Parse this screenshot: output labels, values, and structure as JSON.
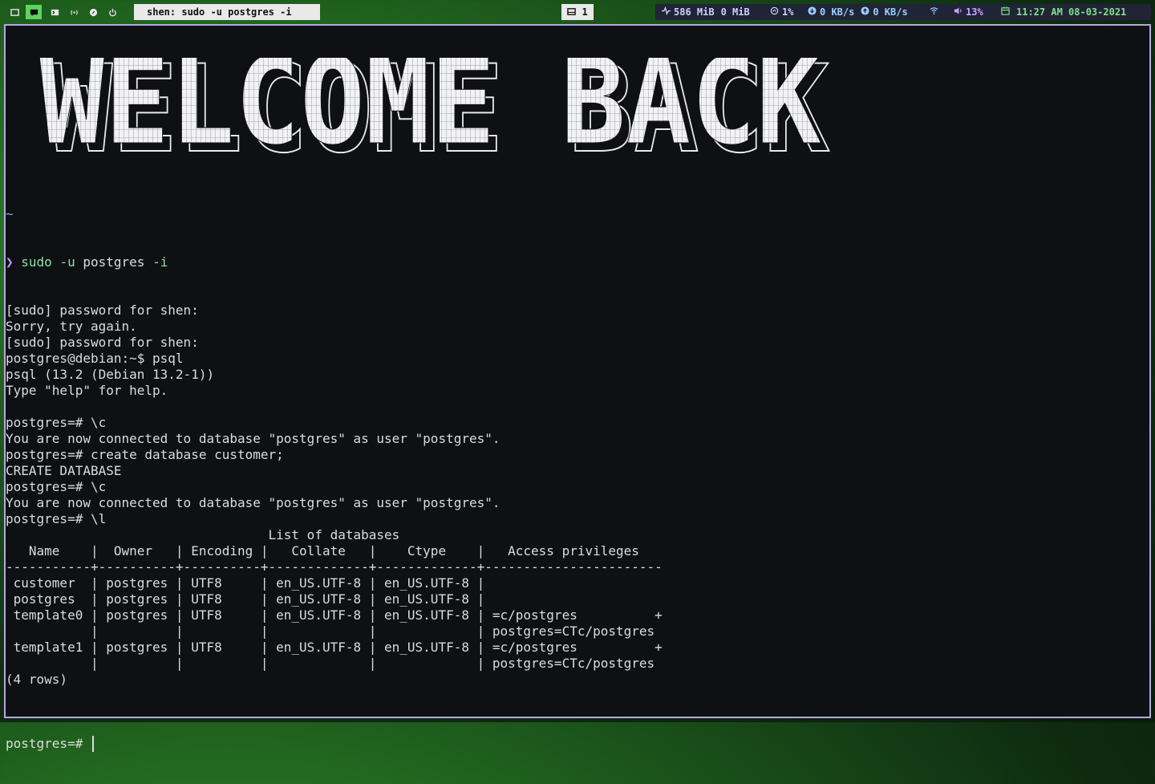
{
  "topbar": {
    "window_title": "shen: sudo -u postgres -i",
    "mail_count": "1",
    "memory": "586 MiB",
    "swap": "0 MiB",
    "cpu": "1%",
    "net_down": "0 KB/s",
    "net_up": "0 KB/s",
    "volume": "13%",
    "clock": "11:27 AM 08-03-2021",
    "colors": {
      "ram": "#c9d1ff",
      "cpu": "#c9d1ff",
      "net": "#9bd0ff",
      "volume": "#c7a6ff",
      "clock": "#7fe08a",
      "bar_bg": "#202436",
      "accent": "#5fd35f"
    },
    "workspace_icons": [
      "terminal-icon",
      "chat-icon",
      "terminal-prompt-icon",
      "broadcast-icon",
      "compass-icon",
      "power-icon"
    ]
  },
  "terminal": {
    "banner_text": "WELCOME BACK",
    "prompt_cwd": "~",
    "prompt_symbol": "❯",
    "command": {
      "bin": "sudo",
      "flag": "-u",
      "user": "postgres",
      "opt": "-i"
    },
    "output": [
      "[sudo] password for shen:",
      "Sorry, try again.",
      "[sudo] password for shen:",
      "postgres@debian:~$ psql",
      "psql (13.2 (Debian 13.2-1))",
      "Type \"help\" for help.",
      "",
      "postgres=# \\c",
      "You are now connected to database \"postgres\" as user \"postgres\".",
      "postgres=# create database customer;",
      "CREATE DATABASE",
      "postgres=# \\c",
      "You are now connected to database \"postgres\" as user \"postgres\".",
      "postgres=# \\l",
      "                                  List of databases",
      "   Name    |  Owner   | Encoding |   Collate   |    Ctype    |   Access privileges",
      "-----------+----------+----------+-------------+-------------+-----------------------",
      " customer  | postgres | UTF8     | en_US.UTF-8 | en_US.UTF-8 |",
      " postgres  | postgres | UTF8     | en_US.UTF-8 | en_US.UTF-8 |",
      " template0 | postgres | UTF8     | en_US.UTF-8 | en_US.UTF-8 | =c/postgres          +",
      "           |          |          |             |             | postgres=CTc/postgres",
      " template1 | postgres | UTF8     | en_US.UTF-8 | en_US.UTF-8 | =c/postgres          +",
      "           |          |          |             |             | postgres=CTc/postgres",
      "(4 rows)",
      ""
    ],
    "prompt_line": "postgres=# "
  }
}
